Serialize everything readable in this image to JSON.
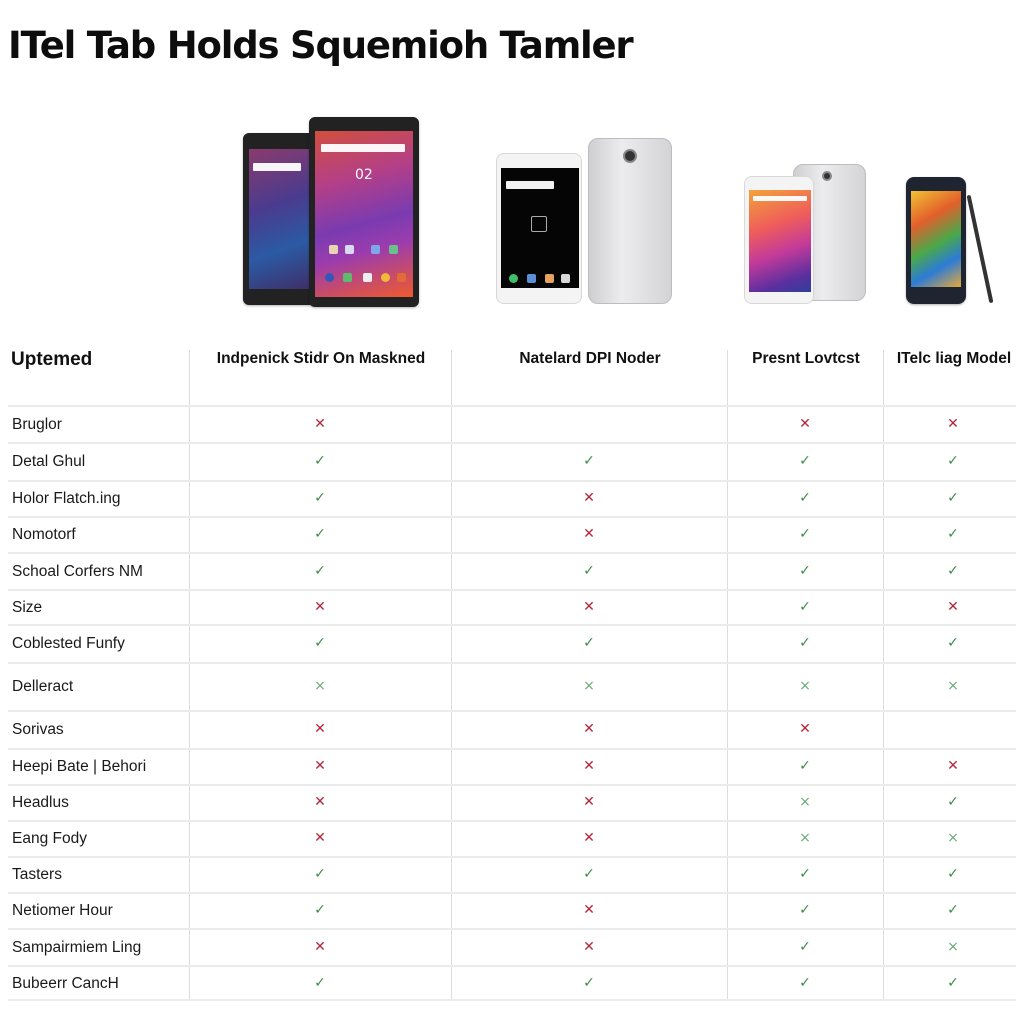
{
  "page": {
    "title": "ITel Tab Holds Squemioh Tamler"
  },
  "products": [
    {
      "id": "p1",
      "name": "Indpenick Stidr On Maskned",
      "image": "tablet-pair-dark"
    },
    {
      "id": "p2",
      "name": "Natelard DPI Noder",
      "image": "phone-white-silver"
    },
    {
      "id": "p3",
      "name": "Presnt Lovtcst",
      "image": "phone-white-silver-small"
    },
    {
      "id": "p4",
      "name": "ITelc liag Model",
      "image": "phone-dark-stylus"
    }
  ],
  "table": {
    "corner_header": "Uptemed",
    "legend": {
      "yes": "✓",
      "no": "✕",
      "partial": "×"
    },
    "colors": {
      "yes": "#3f8c4a",
      "no": "#b3283a",
      "partial": "#6aaa74"
    },
    "rows": [
      {
        "label": "Bruglor",
        "values": [
          "no",
          "",
          "no",
          "no"
        ]
      },
      {
        "label": "Detal Ghul",
        "values": [
          "yes",
          "yes",
          "yes",
          "yes"
        ]
      },
      {
        "label": "Holor Flatch.ing",
        "values": [
          "yes",
          "no",
          "yes",
          "yes"
        ]
      },
      {
        "label": "Nomotorf",
        "values": [
          "yes",
          "no",
          "yes",
          "yes"
        ]
      },
      {
        "label": "Schoal Corfers NM",
        "values": [
          "yes",
          "yes",
          "yes",
          "yes"
        ]
      },
      {
        "label": "Size",
        "values": [
          "no",
          "no",
          "yes",
          "no"
        ]
      },
      {
        "label": "Coblested Funfy",
        "values": [
          "yes",
          "yes",
          "yes",
          "yes"
        ]
      },
      {
        "label": "Delleract",
        "values": [
          "partial",
          "partial",
          "partial",
          "partial"
        ]
      },
      {
        "label": "Sorivas",
        "values": [
          "no",
          "no",
          "no",
          ""
        ]
      },
      {
        "label": "Heepi Bate | Behori",
        "values": [
          "no",
          "no",
          "yes",
          "no"
        ]
      },
      {
        "label": "Headlus",
        "values": [
          "no",
          "no",
          "partial",
          "yes"
        ]
      },
      {
        "label": "Eang Fody",
        "values": [
          "no",
          "no",
          "partial",
          "partial"
        ]
      },
      {
        "label": "Tasters",
        "values": [
          "yes",
          "yes",
          "yes",
          "yes"
        ]
      },
      {
        "label": "Netiomer Hour",
        "values": [
          "yes",
          "no",
          "yes",
          "yes"
        ]
      },
      {
        "label": "Sampairmiem Ling",
        "values": [
          "no",
          "no",
          "yes",
          "partial"
        ]
      },
      {
        "label": "Bubeerr CancH",
        "values": [
          "yes",
          "yes",
          "yes",
          "yes"
        ]
      }
    ]
  },
  "device_screens": {
    "tablet_clock": "02"
  }
}
